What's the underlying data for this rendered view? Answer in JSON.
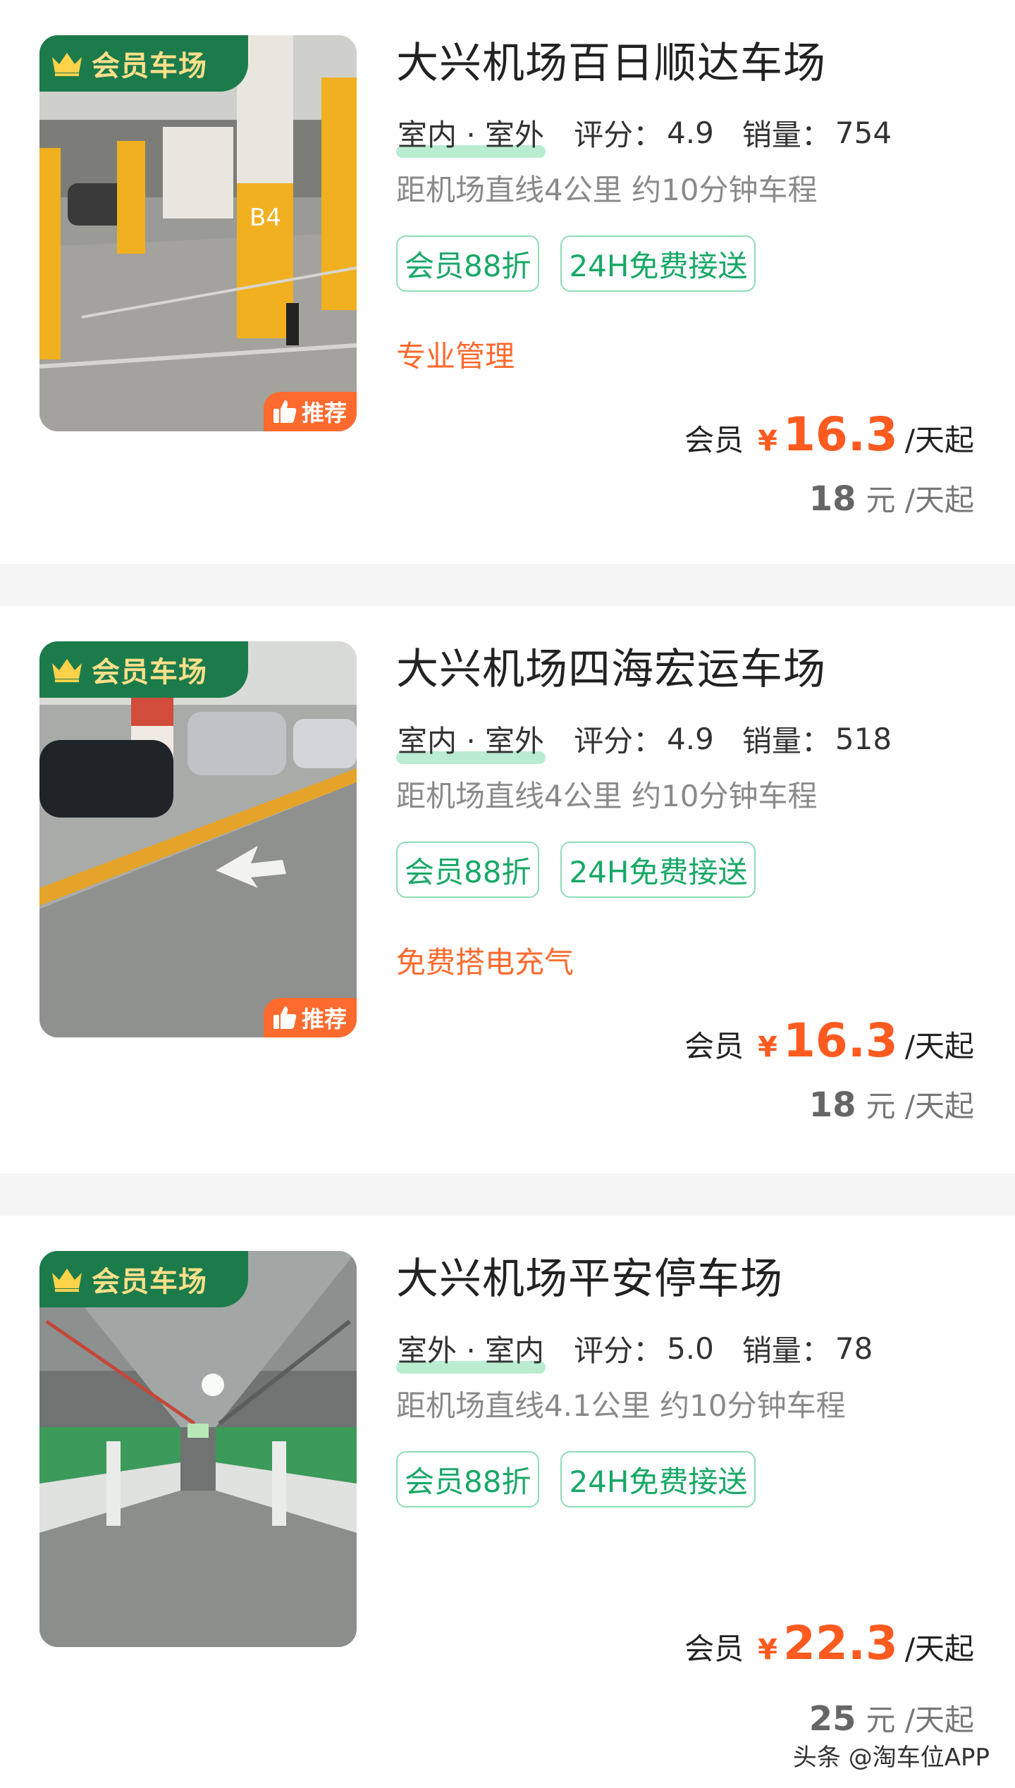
{
  "listings": [
    {
      "member_badge": "会员车场",
      "recommend_badge": "推荐",
      "name": "大兴机场百日顺达车场",
      "type": "室内 · 室外",
      "rating_label": "评分：",
      "rating": "4.9",
      "sales_label": "销量：",
      "sales": "754",
      "distance": "距机场直线4公里 约10分钟车程",
      "tags": [
        "会员88折",
        "24H免费接送"
      ],
      "feature": "专业管理",
      "member_price_label": "会员",
      "currency": "¥",
      "member_price": "16.3",
      "price_unit": "/天起",
      "original_price": "18",
      "original_unit": "元 /天起"
    },
    {
      "member_badge": "会员车场",
      "recommend_badge": "推荐",
      "name": "大兴机场四海宏运车场",
      "type": "室内 · 室外",
      "rating_label": "评分：",
      "rating": "4.9",
      "sales_label": "销量：",
      "sales": "518",
      "distance": "距机场直线4公里 约10分钟车程",
      "tags": [
        "会员88折",
        "24H免费接送"
      ],
      "feature": "免费搭电充气",
      "member_price_label": "会员",
      "currency": "¥",
      "member_price": "16.3",
      "price_unit": "/天起",
      "original_price": "18",
      "original_unit": "元 /天起"
    },
    {
      "member_badge": "会员车场",
      "name": "大兴机场平安停车场",
      "type": "室外 · 室内",
      "rating_label": "评分：",
      "rating": "5.0",
      "sales_label": "销量：",
      "sales": "78",
      "distance": "距机场直线4.1公里 约10分钟车程",
      "tags": [
        "会员88折",
        "24H免费接送"
      ],
      "feature": "",
      "member_price_label": "会员",
      "currency": "¥",
      "member_price": "22.3",
      "price_unit": "/天起",
      "original_price": "25",
      "original_unit": "元 /天起"
    }
  ],
  "watermark": "头条 @淘车位APP",
  "colors": {
    "accent_green": "#18a866",
    "badge_green": "#1c7b4a",
    "price_orange": "#ff5a1f",
    "feature_orange": "#ff6a2e"
  }
}
